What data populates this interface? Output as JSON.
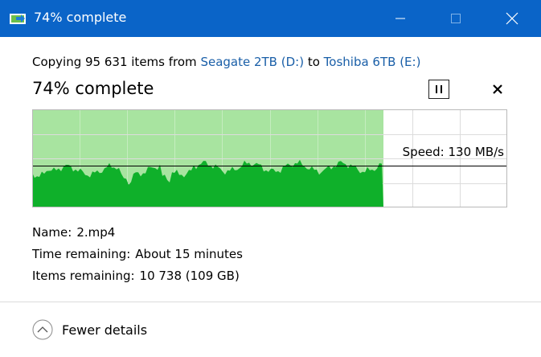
{
  "window": {
    "title": "74% complete",
    "colors": {
      "titlebar": "#0a64c8",
      "graph_light": "#a8e4a0",
      "graph_dark": "#0fb02a",
      "link": "#1a5fa8"
    }
  },
  "copy": {
    "prefix": "Copying 95 631 items from",
    "source": "Seagate 2TB (D:)",
    "connector": "to",
    "destination": "Toshiba 6TB (E:)"
  },
  "progress": {
    "headline": "74% complete",
    "percent": 74,
    "speed_label": "Speed: 130 MB/s"
  },
  "icons": {
    "app": "copy-transfer-icon",
    "pause": "pause-icon",
    "cancel": "close-icon",
    "fewer": "chevron-up-circle-icon"
  },
  "details": {
    "name_label": "Name:",
    "name_value": "2.mp4",
    "time_label": "Time remaining:",
    "time_value": "About 15 minutes",
    "items_label": "Items remaining:",
    "items_value": "10 738 (109 GB)"
  },
  "footer": {
    "fewer_details": "Fewer details"
  }
}
